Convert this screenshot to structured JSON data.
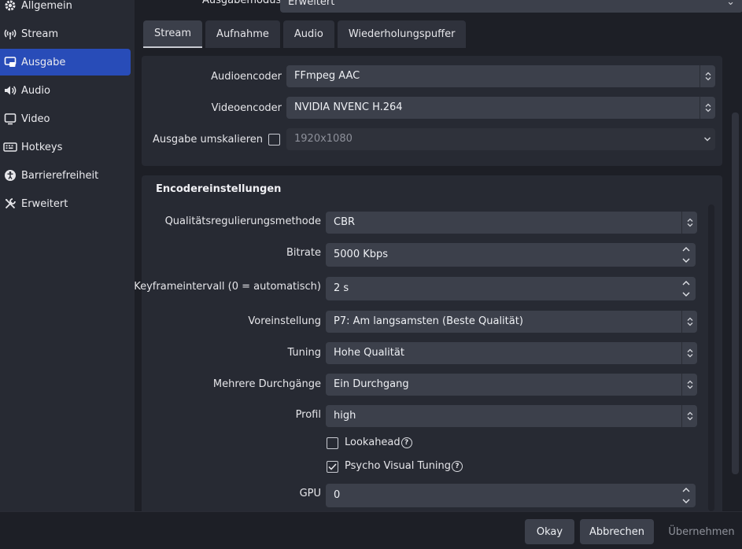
{
  "sidebar": {
    "items": [
      {
        "label": "Allgemein",
        "icon": "gear-icon"
      },
      {
        "label": "Stream",
        "icon": "broadcast-icon"
      },
      {
        "label": "Ausgabe",
        "icon": "output-icon",
        "active": true
      },
      {
        "label": "Audio",
        "icon": "speaker-icon"
      },
      {
        "label": "Video",
        "icon": "monitor-icon"
      },
      {
        "label": "Hotkeys",
        "icon": "keyboard-icon"
      },
      {
        "label": "Barrierefreiheit",
        "icon": "accessibility-icon"
      },
      {
        "label": "Erweitert",
        "icon": "tools-icon"
      }
    ]
  },
  "output_mode": {
    "label": "Ausgabemodus",
    "value": "Erweitert"
  },
  "tabs": [
    "Stream",
    "Aufnahme",
    "Audio",
    "Wiederholungspuffer"
  ],
  "stream": {
    "audio_encoder": {
      "label": "Audioencoder",
      "value": "FFmpeg AAC"
    },
    "video_encoder": {
      "label": "Videoencoder",
      "value": "NVIDIA NVENC H.264"
    },
    "rescale": {
      "label": "Ausgabe umskalieren",
      "value": "1920x1080",
      "checked": false
    }
  },
  "encoder": {
    "title": "Encodereinstellungen",
    "rate_control": {
      "label": "Qualitätsregulierungsmethode",
      "value": "CBR"
    },
    "bitrate": {
      "label": "Bitrate",
      "value": "5000 Kbps"
    },
    "keyframe": {
      "label": "Keyframeintervall (0 = automatisch)",
      "value": "2 s"
    },
    "preset": {
      "label": "Voreinstellung",
      "value": "P7: Am langsamsten (Beste Qualität)"
    },
    "tuning": {
      "label": "Tuning",
      "value": "Hohe Qualität"
    },
    "multipass": {
      "label": "Mehrere Durchgänge",
      "value": "Ein Durchgang"
    },
    "profile": {
      "label": "Profil",
      "value": "high"
    },
    "lookahead": {
      "label": "Lookahead",
      "checked": false
    },
    "psycho": {
      "label": "Psycho Visual Tuning",
      "checked": true
    },
    "gpu": {
      "label": "GPU",
      "value": "0"
    }
  },
  "buttons": {
    "ok": "Okay",
    "cancel": "Abbrechen",
    "apply": "Übernehmen"
  },
  "colors": {
    "accent": "#284cb8",
    "panel": "#272a33",
    "field": "#3c404b",
    "background": "#1d1f26"
  }
}
